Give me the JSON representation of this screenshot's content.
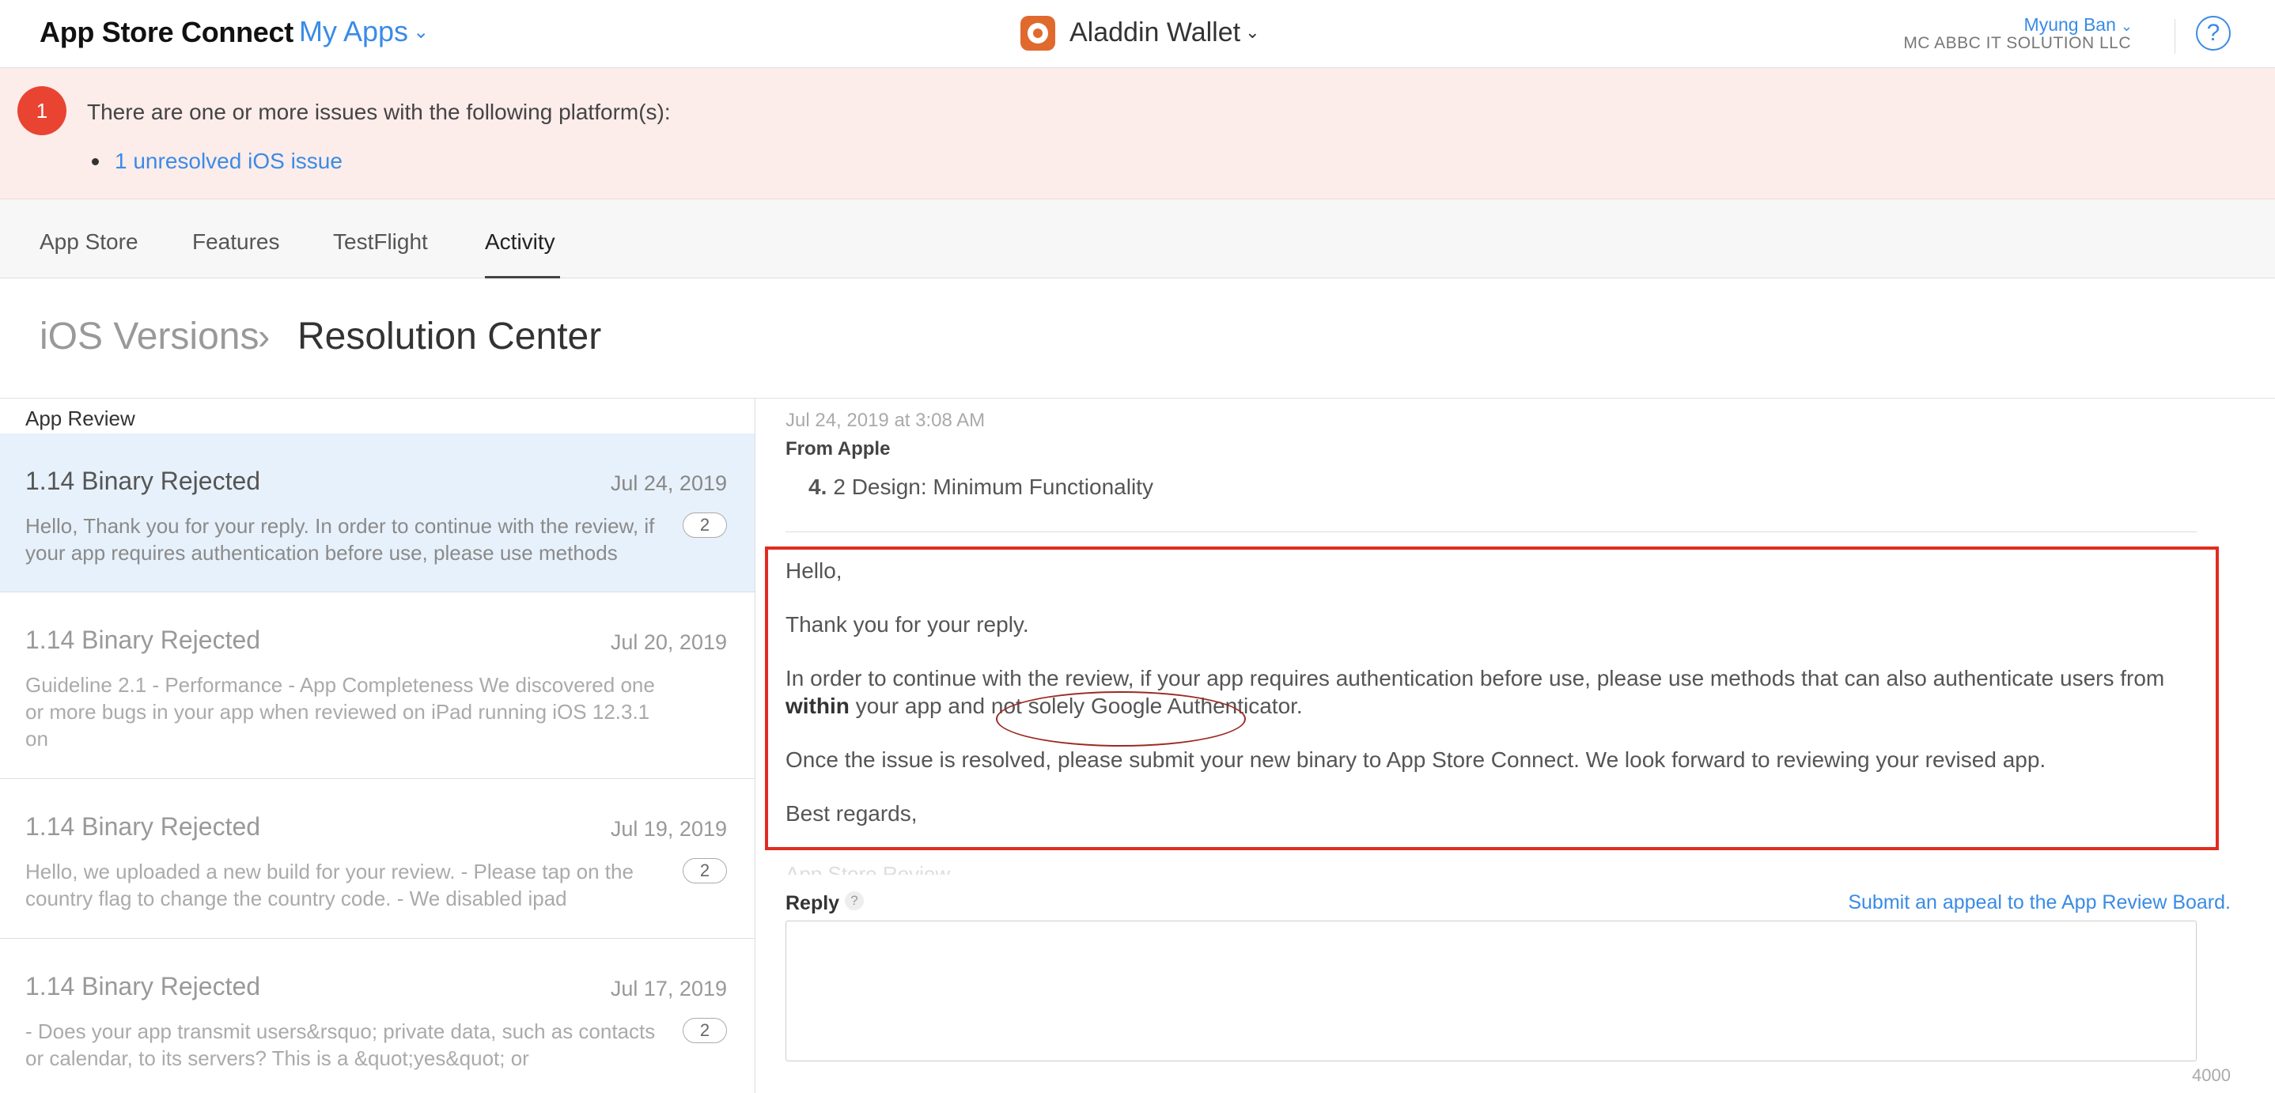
{
  "header": {
    "brand": "App Store Connect",
    "my_apps": "My Apps",
    "app_name": "Aladdin Wallet",
    "user_name": "Myung Ban",
    "company": "MC ABBC IT SOLUTION LLC",
    "help": "?"
  },
  "alert": {
    "count": "1",
    "message": "There are one or more issues with the following platform(s):",
    "link": "1 unresolved iOS issue"
  },
  "tabs": [
    "App Store",
    "Features",
    "TestFlight",
    "Activity"
  ],
  "active_tab": "Activity",
  "breadcrumb": {
    "parent": "iOS Versions",
    "current": "Resolution Center"
  },
  "list": {
    "title": "App Review",
    "items": [
      {
        "title": "1.14 Binary Rejected",
        "date": "Jul 24, 2019",
        "snippet": "Hello, Thank you for your reply. In order to continue with the review, if your app requires authentication before use, please use methods",
        "count": "2",
        "selected": true
      },
      {
        "title": "1.14 Binary Rejected",
        "date": "Jul 20, 2019",
        "snippet": "Guideline 2.1 - Performance - App Completeness We discovered one or more bugs in your app when reviewed on iPad running iOS 12.3.1 on",
        "count": ""
      },
      {
        "title": "1.14 Binary Rejected",
        "date": "Jul 19, 2019",
        "snippet": "Hello, we uploaded a new build for your review. - Please tap on the country flag to change the country code. - We disabled ipad",
        "count": "2"
      },
      {
        "title": "1.14 Binary Rejected",
        "date": "Jul 17, 2019",
        "snippet": "- Does your app transmit users&rsquo; private data, such as contacts or calendar, to its servers? This is a &quot;yes&quot; or",
        "count": "2"
      }
    ]
  },
  "message": {
    "time": "Jul 24, 2019 at 3:08 AM",
    "from": "From Apple",
    "guideline_num": "4.",
    "guideline_text": "2 Design: Minimum Functionality",
    "greeting": "Hello,",
    "thanks": "Thank you for your reply.",
    "body_part1": "In order to continue with the review, if your app requires authentication before use, please use methods that can also authenticate users from ",
    "body_bold": "within",
    "body_part2": " your app and not solely Google Authenticator.",
    "resolved": "Once the issue is resolved, please submit your new binary to App Store Connect. We look forward to reviewing your revised app.",
    "regards": "Best regards,",
    "signature": "App Store Review"
  },
  "reply": {
    "label": "Reply",
    "help": "?",
    "appeal_link": "Submit an appeal to the App Review Board.",
    "char_count": "4000",
    "value": ""
  },
  "colors": {
    "accent": "#3a8be6",
    "alert_bg": "#fcecea",
    "alert_badge": "#e94432",
    "highlight_box": "#e02c20"
  }
}
